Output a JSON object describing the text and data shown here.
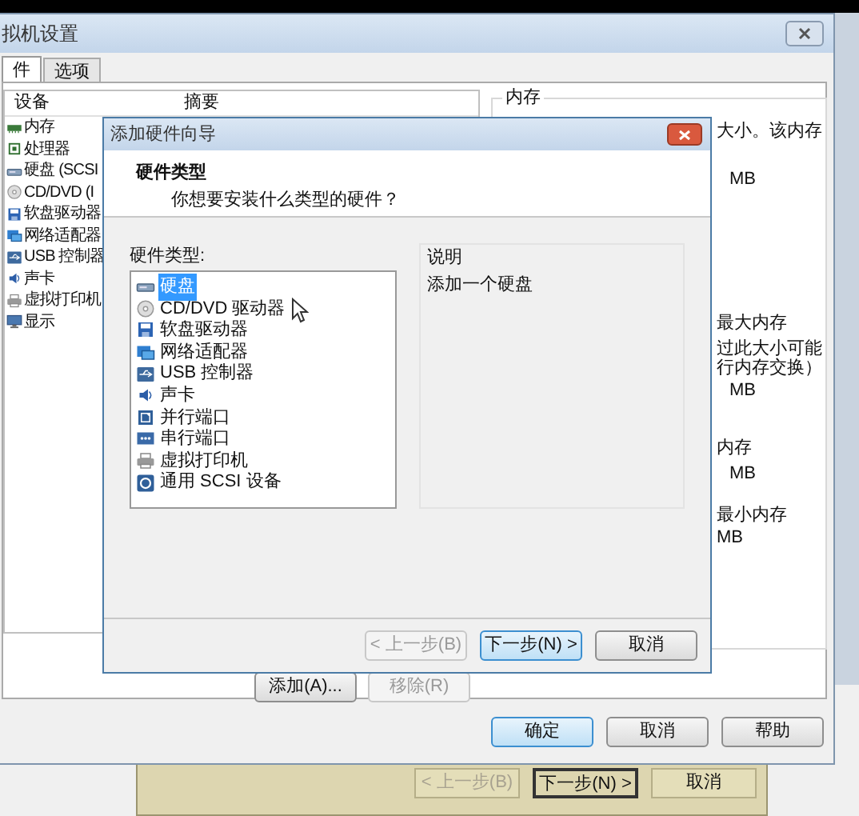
{
  "background_window": {
    "buttons": [
      {
        "label": "< 上一步(B)",
        "disabled": true,
        "default": false
      },
      {
        "label": "下一步(N) >",
        "disabled": false,
        "default": true
      },
      {
        "label": "取消",
        "disabled": false,
        "default": false
      }
    ]
  },
  "settings_window": {
    "title": "拟机设置",
    "tabs": [
      {
        "label": "件",
        "selected": true
      },
      {
        "label": "选项",
        "selected": false
      }
    ],
    "device_list": {
      "columns": [
        "设备",
        "摘要"
      ],
      "items": [
        {
          "kind": "memory",
          "name": "内存"
        },
        {
          "kind": "cpu",
          "name": "处理器"
        },
        {
          "kind": "disk",
          "name": "硬盘 (SCSI"
        },
        {
          "kind": "cdrom",
          "name": "CD/DVD (I"
        },
        {
          "kind": "floppy",
          "name": "软盘驱动器"
        },
        {
          "kind": "network",
          "name": "网络适配器"
        },
        {
          "kind": "usb",
          "name": "USB 控制器"
        },
        {
          "kind": "sound",
          "name": "声卡"
        },
        {
          "kind": "printer",
          "name": "虚拟打印机"
        },
        {
          "kind": "display",
          "name": "显示"
        }
      ]
    },
    "list_buttons": [
      {
        "label": "添加(A)...",
        "disabled": false
      },
      {
        "label": "移除(R)",
        "disabled": true
      }
    ],
    "memory_group": {
      "title": "内存",
      "lines": [
        "大小。该内存",
        "MB",
        "最大内存",
        "过此大小可能",
        "行内存交换）",
        "MB",
        "内存",
        "MB",
        "最小内存",
        "MB"
      ]
    },
    "buttons": [
      {
        "label": "确定",
        "default": true
      },
      {
        "label": "取消",
        "default": false
      },
      {
        "label": "帮助",
        "default": false
      }
    ]
  },
  "wizard": {
    "title": "添加硬件向导",
    "heading": "硬件类型",
    "subheading": "你想要安装什么类型的硬件？",
    "list_label": "硬件类型:",
    "hardware_types": [
      {
        "kind": "disk",
        "name": "硬盘",
        "selected": true
      },
      {
        "kind": "cdrom",
        "name": "CD/DVD 驱动器",
        "selected": false
      },
      {
        "kind": "floppy",
        "name": "软盘驱动器",
        "selected": false
      },
      {
        "kind": "network",
        "name": "网络适配器",
        "selected": false
      },
      {
        "kind": "usb",
        "name": "USB 控制器",
        "selected": false
      },
      {
        "kind": "sound",
        "name": "声卡",
        "selected": false
      },
      {
        "kind": "parallel",
        "name": "并行端口",
        "selected": false
      },
      {
        "kind": "serial",
        "name": "串行端口",
        "selected": false
      },
      {
        "kind": "printer",
        "name": "虚拟打印机",
        "selected": false
      },
      {
        "kind": "scsi",
        "name": "通用 SCSI 设备",
        "selected": false
      }
    ],
    "description_label": "说明",
    "description": "添加一个硬盘",
    "buttons": [
      {
        "label": "< 上一步(B)",
        "disabled": true,
        "default": false
      },
      {
        "label": "下一步(N) >",
        "disabled": false,
        "default": true
      },
      {
        "label": "取消",
        "disabled": false,
        "default": false
      }
    ]
  }
}
